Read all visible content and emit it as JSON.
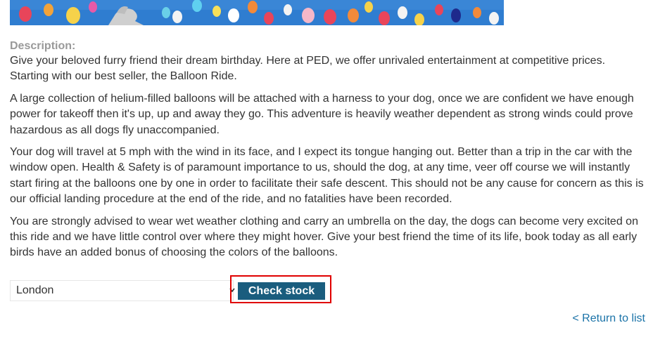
{
  "product": {
    "image_alt": "balloon-ride-product-image"
  },
  "description": {
    "label": "Description:",
    "paragraphs": [
      "Give your beloved furry friend their dream birthday. Here at PED, we offer unrivaled entertainment at competitive prices. Starting with our best seller, the Balloon Ride.",
      "A large collection of helium-filled balloons will be attached with a harness to your dog, once we are confident we have enough power for takeoff then it's up, up and away they go. This adventure is heavily weather dependent as strong winds could prove hazardous as all dogs fly unaccompanied.",
      "Your dog will travel at 5 mph with the wind in its face, and I expect its tongue hanging out. Better than a trip in the car with the window open. Health & Safety is of paramount importance to us, should the dog, at any time, veer off course we will instantly start firing at the balloons one by one in order to facilitate their safe descent. This should not be any cause for concern as this is our official landing procedure at the end of the ride, and no fatalities have been recorded.",
      "You are strongly advised to wear wet weather clothing and carry an umbrella on the day, the dogs can become very excited on this ride and we have little control over where they might hover. Give your best friend the time of its life, book today as all early birds have an added bonus of choosing the colors of the balloons."
    ]
  },
  "stock_check": {
    "selected_store": "London",
    "button_label": "Check stock",
    "highlight_color": "#e00000",
    "button_color": "#1a5d7e"
  },
  "navigation": {
    "return_link": "< Return to list"
  },
  "icons": {
    "select_arrow": "chevron-down-icon"
  }
}
